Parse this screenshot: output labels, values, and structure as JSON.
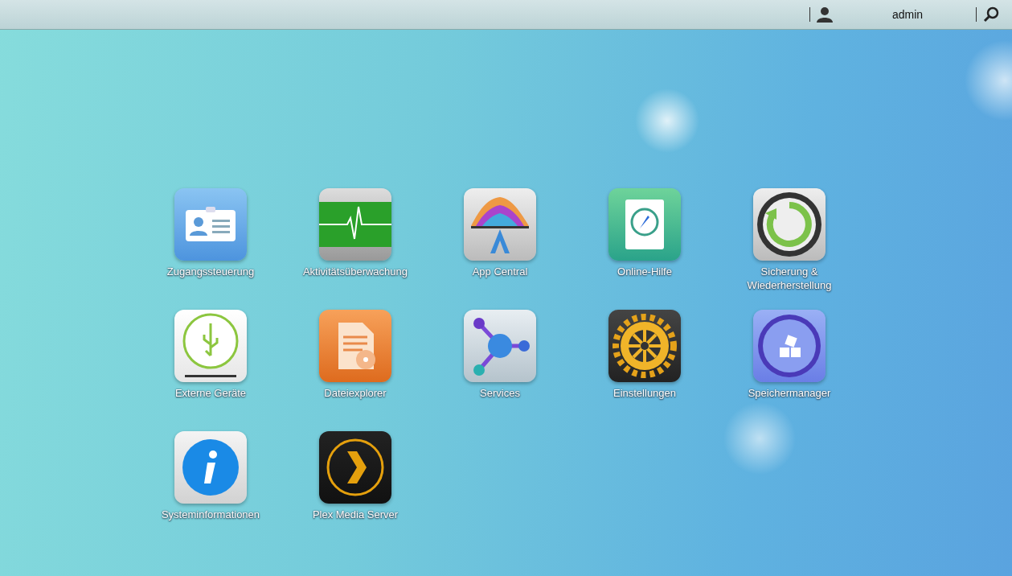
{
  "top_bar": {
    "user": "admin"
  },
  "apps": [
    {
      "label": "Zugangssteuerung",
      "kind": "access"
    },
    {
      "label": "Aktivitätsüberwachung",
      "kind": "monitor"
    },
    {
      "label": "App Central",
      "kind": "appcentral"
    },
    {
      "label": "Online-Hilfe",
      "kind": "help"
    },
    {
      "label": "Sicherung & Wiederherstellung",
      "kind": "backup"
    },
    {
      "label": "Externe Geräte",
      "kind": "usb"
    },
    {
      "label": "Dateiexplorer",
      "kind": "files"
    },
    {
      "label": "Services",
      "kind": "services"
    },
    {
      "label": "Einstellungen",
      "kind": "settings"
    },
    {
      "label": "Speichermanager",
      "kind": "storage"
    },
    {
      "label": "Systeminformationen",
      "kind": "info"
    },
    {
      "label": "Plex Media Server",
      "kind": "plex"
    }
  ]
}
